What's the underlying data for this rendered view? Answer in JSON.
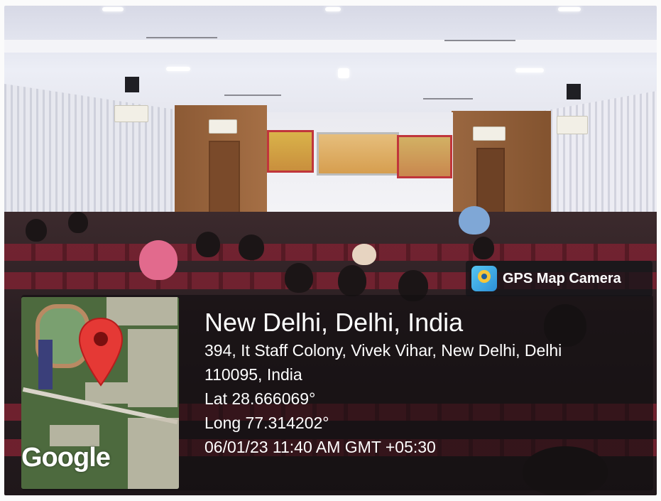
{
  "badge": {
    "app_name": "GPS Map Camera",
    "icon": "gps-map-camera-icon"
  },
  "map": {
    "provider_logo": "Google",
    "pin_icon": "location-pin-icon"
  },
  "location": {
    "city_line": "New Delhi, Delhi, India",
    "address_line1": "394, It Staff Colony, Vivek Vihar, New Delhi, Delhi",
    "address_line2": "110095, India",
    "latitude": "Lat 28.666069°",
    "longitude": "Long 77.314202°",
    "datetime": "06/01/23 11:40 AM GMT +05:30"
  },
  "colors": {
    "pin_red": "#e53935",
    "overlay_bg": "#121012",
    "text": "#ffffff"
  }
}
